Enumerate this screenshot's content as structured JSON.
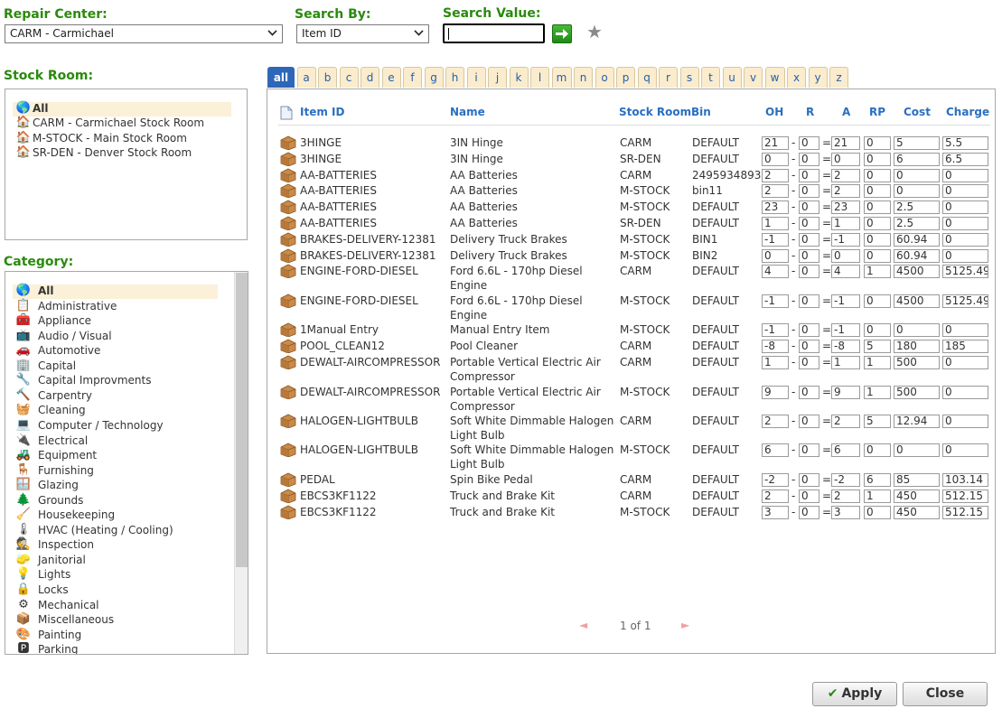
{
  "filters": {
    "repair_center_label": "Repair Center:",
    "repair_center_value": "CARM - Carmichael",
    "search_by_label": "Search By:",
    "search_by_value": "Item ID",
    "search_value_label": "Search Value:",
    "search_value": ""
  },
  "stock_room": {
    "label": "Stock Room:",
    "items": [
      "All",
      "CARM - Carmichael Stock Room",
      "M-STOCK - Main Stock Room",
      "SR-DEN - Denver Stock Room"
    ],
    "selected": "All"
  },
  "category": {
    "label": "Category:",
    "items": [
      {
        "label": "All",
        "icon": "globe-icon"
      },
      {
        "label": "Administrative",
        "icon": "administrative-icon"
      },
      {
        "label": "Appliance",
        "icon": "appliance-icon"
      },
      {
        "label": "Audio / Visual",
        "icon": "audio-visual-icon"
      },
      {
        "label": "Automotive",
        "icon": "automotive-icon"
      },
      {
        "label": "Capital",
        "icon": "capital-icon"
      },
      {
        "label": "Capital Improvments",
        "icon": "tools-icon"
      },
      {
        "label": "Carpentry",
        "icon": "hammer-icon"
      },
      {
        "label": "Cleaning",
        "icon": "bucket-icon"
      },
      {
        "label": "Computer / Technology",
        "icon": "computer-icon"
      },
      {
        "label": "Electrical",
        "icon": "electrical-icon"
      },
      {
        "label": "Equipment",
        "icon": "equipment-icon"
      },
      {
        "label": "Furnishing",
        "icon": "furnishing-icon"
      },
      {
        "label": "Glazing",
        "icon": "glazing-icon"
      },
      {
        "label": "Grounds",
        "icon": "tree-icon"
      },
      {
        "label": "Housekeeping",
        "icon": "housekeeping-icon"
      },
      {
        "label": "HVAC (Heating / Cooling)",
        "icon": "hvac-icon"
      },
      {
        "label": "Inspection",
        "icon": "inspector-icon"
      },
      {
        "label": "Janitorial",
        "icon": "janitorial-icon"
      },
      {
        "label": "Lights",
        "icon": "bulb-icon"
      },
      {
        "label": "Locks",
        "icon": "lock-icon"
      },
      {
        "label": "Mechanical",
        "icon": "gear-icon"
      },
      {
        "label": "Miscellaneous",
        "icon": "miscellaneous-icon"
      },
      {
        "label": "Painting",
        "icon": "paint-icon"
      },
      {
        "label": "Parking",
        "icon": "parking-icon"
      }
    ],
    "selected": "All"
  },
  "tabs": [
    "all",
    "a",
    "b",
    "c",
    "d",
    "e",
    "f",
    "g",
    "h",
    "i",
    "j",
    "k",
    "l",
    "m",
    "n",
    "o",
    "p",
    "q",
    "r",
    "s",
    "t",
    "u",
    "v",
    "w",
    "x",
    "y",
    "z"
  ],
  "active_tab": "all",
  "grid": {
    "columns": [
      "Item ID",
      "Name",
      "Stock Room",
      "Bin",
      "OH",
      "R",
      "A",
      "RP",
      "Cost",
      "Charge"
    ],
    "rows": [
      {
        "id": "3HINGE",
        "name": "3IN Hinge",
        "room": "CARM",
        "bin": "DEFAULT",
        "oh": "21",
        "r": "0",
        "a": "21",
        "rp": "0",
        "cost": "5",
        "charge": "5.5"
      },
      {
        "id": "3HINGE",
        "name": "3IN Hinge",
        "room": "SR-DEN",
        "bin": "DEFAULT",
        "oh": "0",
        "r": "0",
        "a": "0",
        "rp": "0",
        "cost": "6",
        "charge": "6.5"
      },
      {
        "id": "AA-BATTERIES",
        "name": "AA Batteries",
        "room": "CARM",
        "bin": "2495934893",
        "oh": "2",
        "r": "0",
        "a": "2",
        "rp": "0",
        "cost": "0",
        "charge": "0"
      },
      {
        "id": "AA-BATTERIES",
        "name": "AA Batteries",
        "room": "M-STOCK",
        "bin": "bin11",
        "oh": "2",
        "r": "0",
        "a": "2",
        "rp": "0",
        "cost": "0",
        "charge": "0"
      },
      {
        "id": "AA-BATTERIES",
        "name": "AA Batteries",
        "room": "M-STOCK",
        "bin": "DEFAULT",
        "oh": "23",
        "r": "0",
        "a": "23",
        "rp": "0",
        "cost": "2.5",
        "charge": "0"
      },
      {
        "id": "AA-BATTERIES",
        "name": "AA Batteries",
        "room": "SR-DEN",
        "bin": "DEFAULT",
        "oh": "1",
        "r": "0",
        "a": "1",
        "rp": "0",
        "cost": "2.5",
        "charge": "0"
      },
      {
        "id": "BRAKES-DELIVERY-12381",
        "name": "Delivery Truck Brakes",
        "room": "M-STOCK",
        "bin": "BIN1",
        "oh": "-1",
        "r": "0",
        "a": "-1",
        "rp": "0",
        "cost": "60.94",
        "charge": "0"
      },
      {
        "id": "BRAKES-DELIVERY-12381",
        "name": "Delivery Truck Brakes",
        "room": "M-STOCK",
        "bin": "BIN2",
        "oh": "0",
        "r": "0",
        "a": "0",
        "rp": "0",
        "cost": "60.94",
        "charge": "0"
      },
      {
        "id": "ENGINE-FORD-DIESEL",
        "name": "Ford 6.6L - 170hp Diesel Engine",
        "room": "CARM",
        "bin": "DEFAULT",
        "oh": "4",
        "r": "0",
        "a": "4",
        "rp": "1",
        "cost": "4500",
        "charge": "5125.49"
      },
      {
        "id": "ENGINE-FORD-DIESEL",
        "name": "Ford 6.6L - 170hp Diesel Engine",
        "room": "M-STOCK",
        "bin": "DEFAULT",
        "oh": "-1",
        "r": "0",
        "a": "-1",
        "rp": "0",
        "cost": "4500",
        "charge": "5125.49"
      },
      {
        "id": "1Manual Entry",
        "name": "Manual Entry Item",
        "room": "M-STOCK",
        "bin": "DEFAULT",
        "oh": "-1",
        "r": "0",
        "a": "-1",
        "rp": "0",
        "cost": "0",
        "charge": "0"
      },
      {
        "id": "POOL_CLEAN12",
        "name": "Pool Cleaner",
        "room": "CARM",
        "bin": "DEFAULT",
        "oh": "-8",
        "r": "0",
        "a": "-8",
        "rp": "5",
        "cost": "180",
        "charge": "185"
      },
      {
        "id": "DEWALT-AIRCOMPRESSOR",
        "name": "Portable Vertical Electric Air Compressor",
        "room": "CARM",
        "bin": "DEFAULT",
        "oh": "1",
        "r": "0",
        "a": "1",
        "rp": "1",
        "cost": "500",
        "charge": "0"
      },
      {
        "id": "DEWALT-AIRCOMPRESSOR",
        "name": "Portable Vertical Electric Air Compressor",
        "room": "M-STOCK",
        "bin": "DEFAULT",
        "oh": "9",
        "r": "0",
        "a": "9",
        "rp": "1",
        "cost": "500",
        "charge": "0"
      },
      {
        "id": "HALOGEN-LIGHTBULB",
        "name": "Soft White Dimmable Halogen Light Bulb",
        "room": "CARM",
        "bin": "DEFAULT",
        "oh": "2",
        "r": "0",
        "a": "2",
        "rp": "5",
        "cost": "12.94",
        "charge": "0"
      },
      {
        "id": "HALOGEN-LIGHTBULB",
        "name": "Soft White Dimmable Halogen Light Bulb",
        "room": "M-STOCK",
        "bin": "DEFAULT",
        "oh": "6",
        "r": "0",
        "a": "6",
        "rp": "0",
        "cost": "0",
        "charge": "0"
      },
      {
        "id": "PEDAL",
        "name": "Spin Bike Pedal",
        "room": "CARM",
        "bin": "DEFAULT",
        "oh": "-2",
        "r": "0",
        "a": "-2",
        "rp": "6",
        "cost": "85",
        "charge": "103.14"
      },
      {
        "id": "EBCS3KF1122",
        "name": "Truck and Brake Kit",
        "room": "CARM",
        "bin": "DEFAULT",
        "oh": "2",
        "r": "0",
        "a": "2",
        "rp": "1",
        "cost": "450",
        "charge": "512.15"
      },
      {
        "id": "EBCS3KF1122",
        "name": "Truck and Brake Kit",
        "room": "M-STOCK",
        "bin": "DEFAULT",
        "oh": "3",
        "r": "0",
        "a": "3",
        "rp": "0",
        "cost": "450",
        "charge": "512.15"
      }
    ]
  },
  "pager": {
    "text": "1 of 1",
    "prev": "◄",
    "next": "►"
  },
  "buttons": {
    "apply": "Apply",
    "apply_check": "✔",
    "close": "Close"
  },
  "colors": {
    "label_green": "#2a8a0d",
    "header_blue": "#2a6fc0",
    "active_tab": "#2f67b8",
    "selection": "#fbf0d8"
  }
}
